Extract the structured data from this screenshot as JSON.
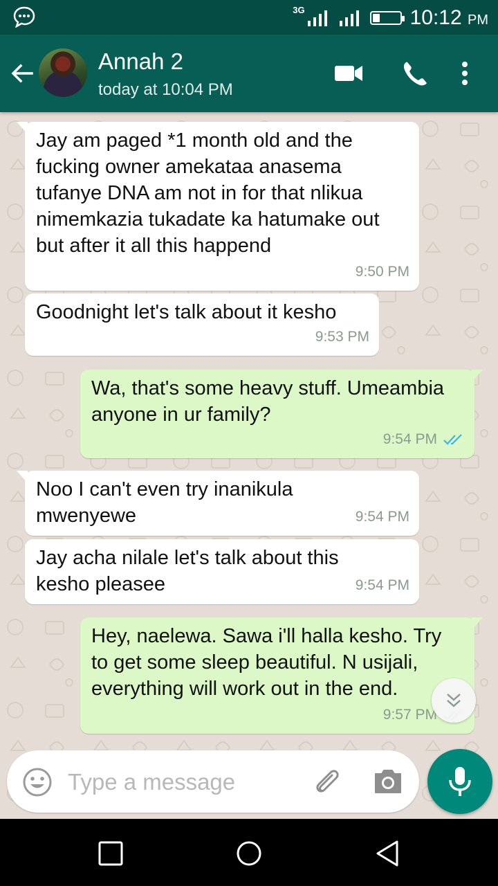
{
  "status_bar": {
    "network": "3G",
    "time": "10:12",
    "ampm": "PM",
    "battery_level": 0.25
  },
  "header": {
    "contact_name": "Annah 2",
    "last_seen": "today at 10:04 PM",
    "icons": [
      "back-arrow-icon",
      "video-call-icon",
      "phone-icon",
      "more-vert-icon"
    ]
  },
  "messages": [
    {
      "direction": "in",
      "text": "Jay am paged *1 month old and the fucking owner amekataa anasema tufanye DNA am not in for that nlikua nimemkazia tukadate ka hatumake out but after it all this happend",
      "time": "9:50 PM"
    },
    {
      "direction": "in",
      "text": "Goodnight let's talk about it kesho",
      "time": "9:53 PM"
    },
    {
      "direction": "out",
      "text": "Wa, that's some heavy stuff. Umeambia anyone in ur family?",
      "time": "9:54 PM",
      "status": "read"
    },
    {
      "direction": "in",
      "text": "Noo I can't even try inanikula mwenyewe",
      "time": "9:54 PM"
    },
    {
      "direction": "in",
      "text": "Jay acha nilale let's talk about this kesho pleasee",
      "time": "9:54 PM"
    },
    {
      "direction": "out",
      "text": "Hey, naelewa. Sawa i'll halla kesho. Try to get some sleep beautiful. N usijali, everything will work out in the end.",
      "time": "9:57 PM",
      "status": "read"
    }
  ],
  "composer": {
    "placeholder": "Type a message",
    "value": ""
  },
  "colors": {
    "header": "#075e54",
    "status_bar": "#054d44",
    "outgoing_bubble": "#dcf8c6",
    "incoming_bubble": "#ffffff",
    "mic_button": "#00897b",
    "read_ticks": "#34b7f1"
  }
}
